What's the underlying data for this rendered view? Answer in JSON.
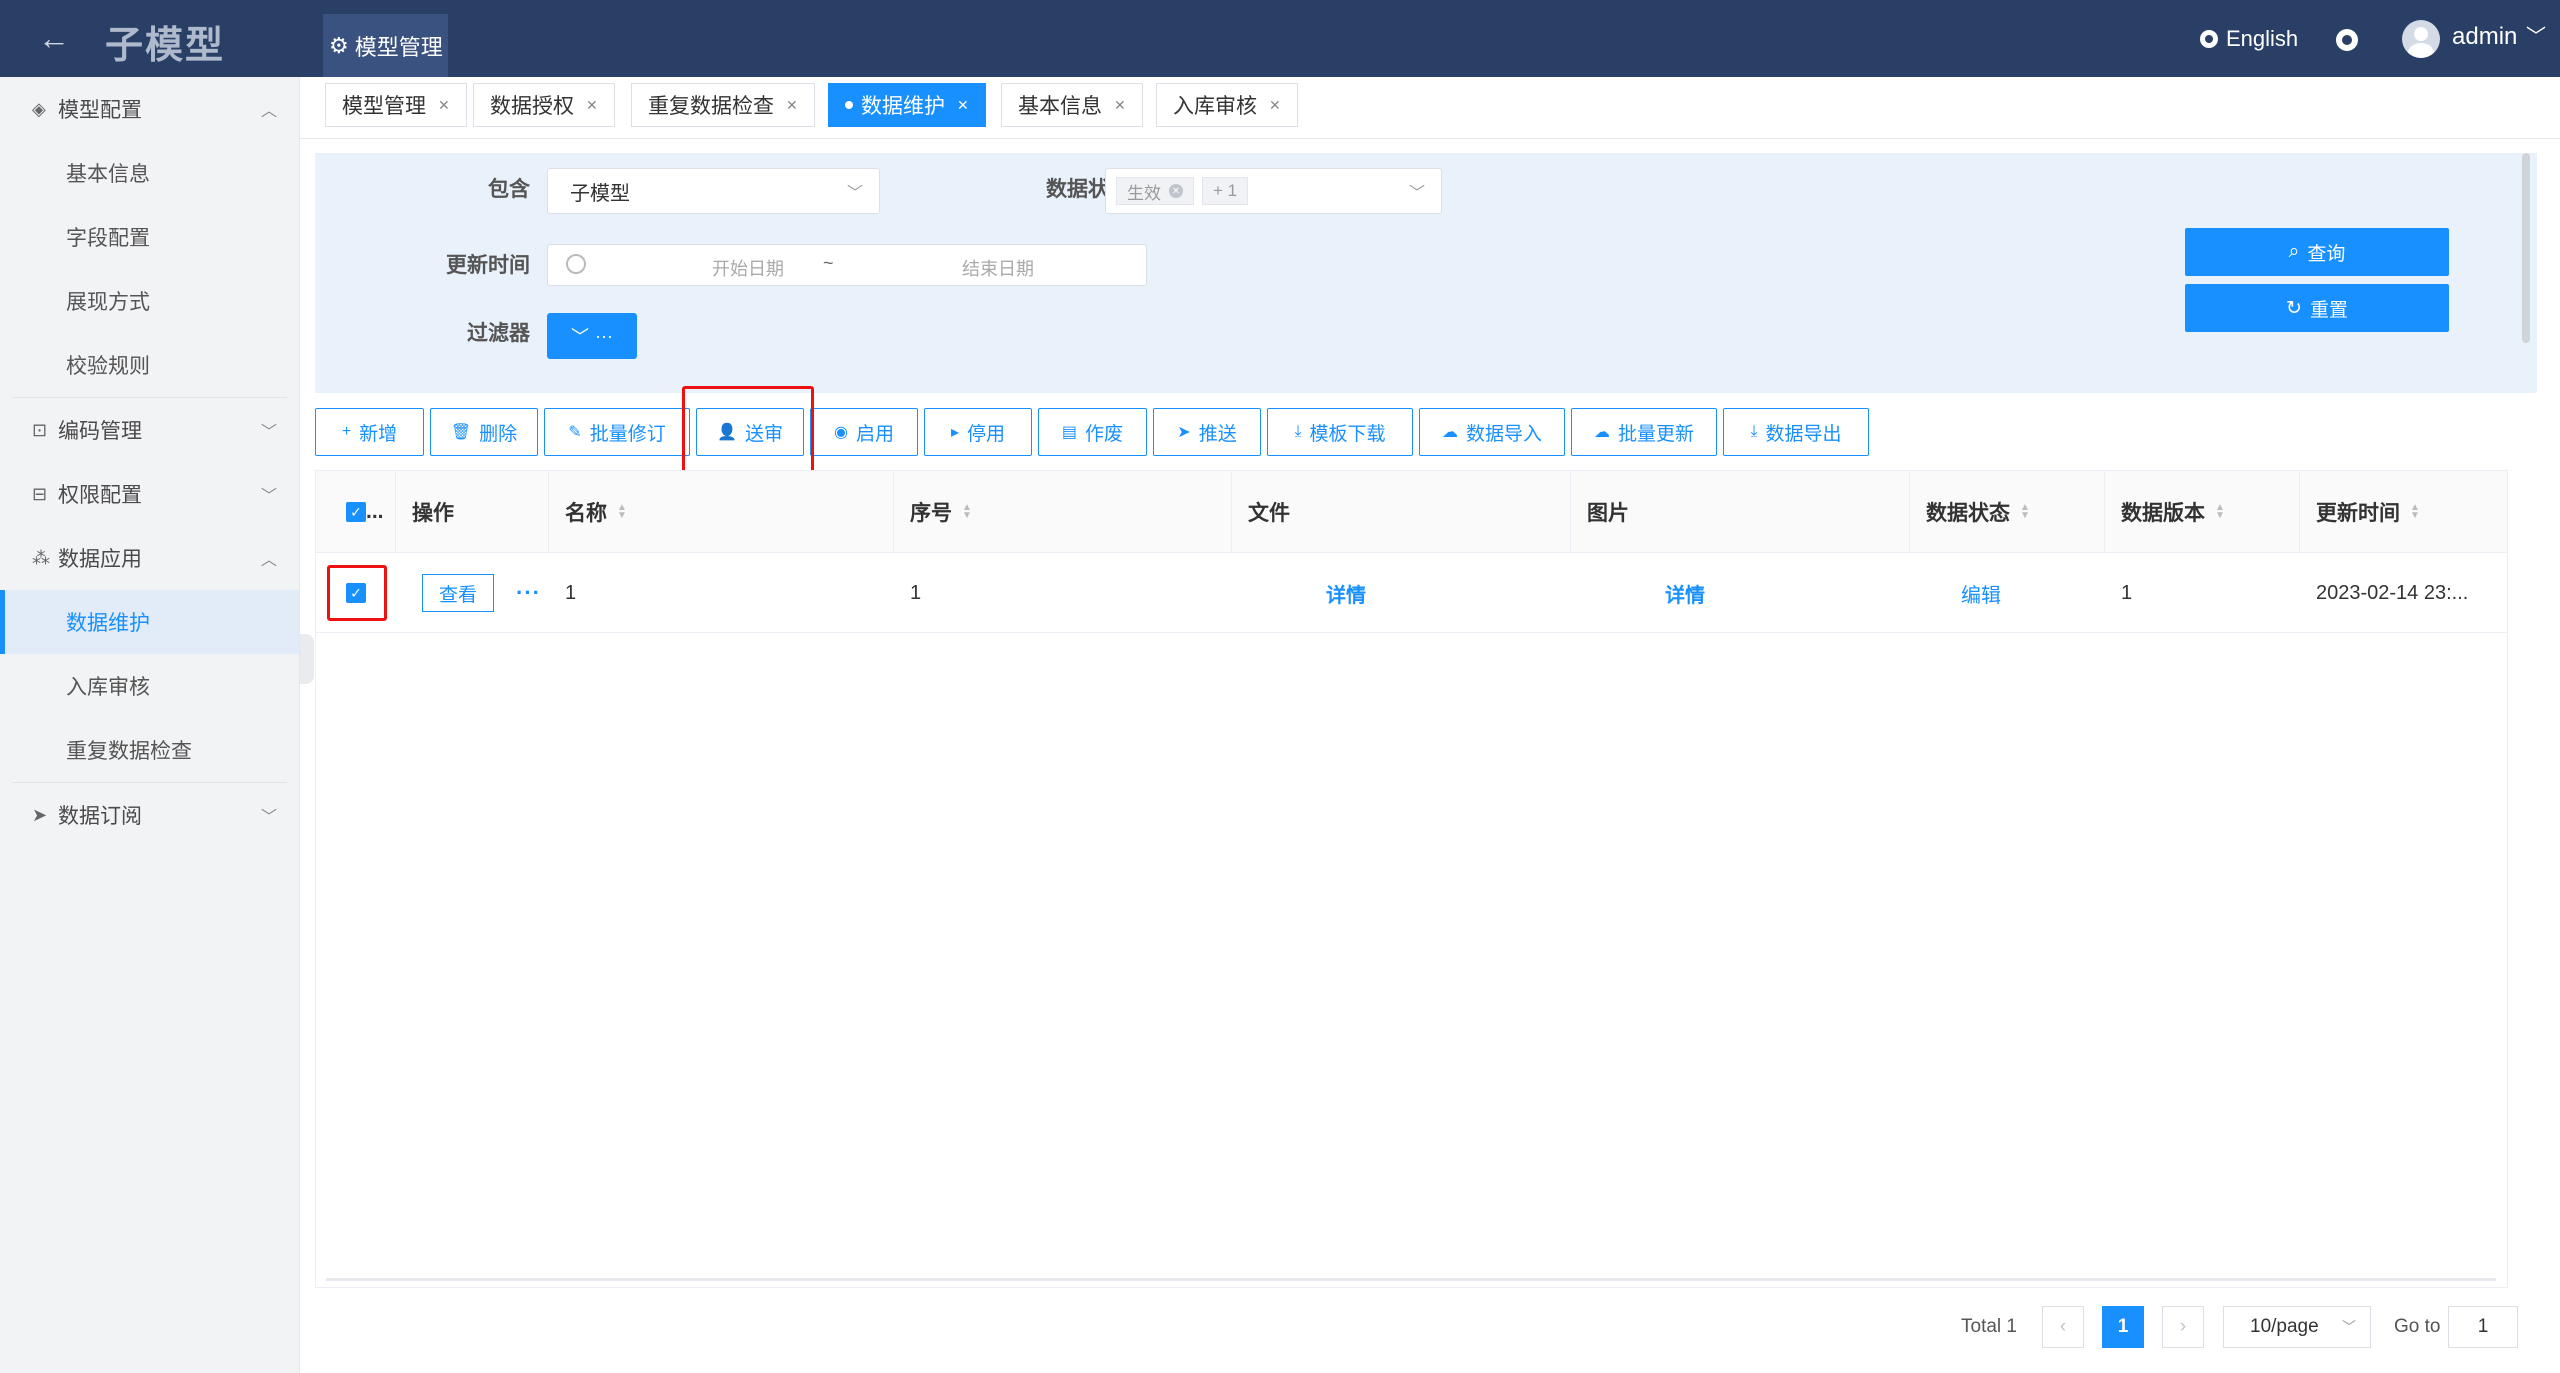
{
  "header": {
    "back_symbol": "←",
    "app_title": "子模型",
    "top_tab": "模型管理",
    "language": "English",
    "user": "admin"
  },
  "sidebar": {
    "groups": [
      {
        "label": "模型配置",
        "icon": "layers-icon",
        "expanded": true,
        "items": [
          "基本信息",
          "字段配置",
          "展现方式",
          "校验规则"
        ]
      },
      {
        "label": "编码管理",
        "icon": "code-icon",
        "expanded": false
      },
      {
        "label": "权限配置",
        "icon": "permission-icon",
        "expanded": false
      },
      {
        "label": "数据应用",
        "icon": "apps-icon",
        "expanded": true,
        "items": [
          "数据维护",
          "入库审核",
          "重复数据检查"
        ],
        "active_item": "数据维护"
      },
      {
        "label": "数据订阅",
        "icon": "send-icon",
        "expanded": false
      }
    ]
  },
  "tabs": [
    {
      "label": "模型管理",
      "active": false
    },
    {
      "label": "数据授权",
      "active": false
    },
    {
      "label": "重复数据检查",
      "active": false
    },
    {
      "label": "数据维护",
      "active": true
    },
    {
      "label": "基本信息",
      "active": false
    },
    {
      "label": "入库审核",
      "active": false
    }
  ],
  "filter": {
    "contain_label": "包含",
    "contain_value": "子模型",
    "status_label": "数据状态",
    "status_tag": "生效",
    "status_more": "+ 1",
    "update_label": "更新时间",
    "start_placeholder": "开始日期",
    "range_sep": "~",
    "end_placeholder": "结束日期",
    "filter_label": "过滤器",
    "filter_btn": "···",
    "query_btn": "查询",
    "reset_btn": "重置"
  },
  "toolbar": [
    {
      "label": "新增",
      "icon": "plus-icon"
    },
    {
      "label": "删除",
      "icon": "trash-icon"
    },
    {
      "label": "批量修订",
      "icon": "edit-icon"
    },
    {
      "label": "送审",
      "icon": "user-icon"
    },
    {
      "label": "启用",
      "icon": "play-circle-icon"
    },
    {
      "label": "停用",
      "icon": "caret-right-icon"
    },
    {
      "label": "作废",
      "icon": "file-icon"
    },
    {
      "label": "推送",
      "icon": "send-icon"
    },
    {
      "label": "模板下载",
      "icon": "download-icon"
    },
    {
      "label": "数据导入",
      "icon": "cloud-upload-icon"
    },
    {
      "label": "批量更新",
      "icon": "cloud-upload-icon"
    },
    {
      "label": "数据导出",
      "icon": "download-icon"
    }
  ],
  "table": {
    "columns": [
      "操作",
      "名称",
      "序号",
      "文件",
      "图片",
      "数据状态",
      "数据版本",
      "更新时间"
    ],
    "select_all_label": "...",
    "rows": [
      {
        "view": "查看",
        "more": "···",
        "name": "1",
        "seq": "1",
        "file": "详情",
        "image": "详情",
        "status": "编辑",
        "version": "1",
        "updated": "2023-02-14 23:..."
      }
    ]
  },
  "pagination": {
    "total": "Total 1",
    "prev": "‹",
    "current": "1",
    "next": "›",
    "page_size": "10/page",
    "goto_label": "Go to",
    "goto_value": "1"
  },
  "colors": {
    "primary": "#1890ff",
    "header_bg": "#2a3f66",
    "highlight": "#ee1111"
  }
}
